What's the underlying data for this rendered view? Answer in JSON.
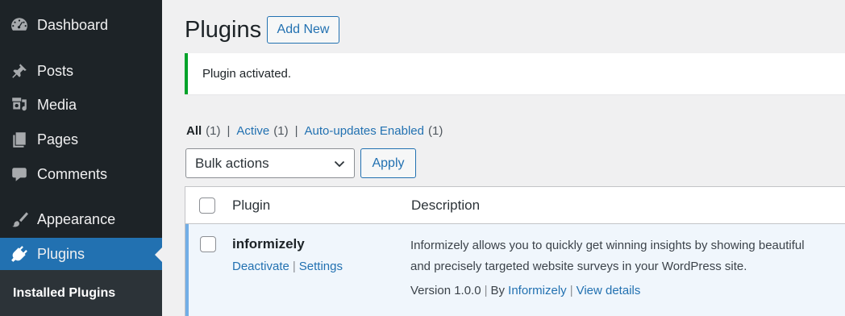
{
  "sidebar": {
    "items": [
      {
        "label": "Dashboard",
        "icon": "dashboard-icon"
      },
      {
        "label": "Posts",
        "icon": "pin-icon"
      },
      {
        "label": "Media",
        "icon": "media-icon"
      },
      {
        "label": "Pages",
        "icon": "pages-icon"
      },
      {
        "label": "Comments",
        "icon": "comment-icon"
      },
      {
        "label": "Appearance",
        "icon": "brush-icon"
      },
      {
        "label": "Plugins",
        "icon": "plug-icon",
        "current": true
      }
    ],
    "submenu": {
      "label": "Installed Plugins"
    }
  },
  "header": {
    "title": "Plugins",
    "add_new_label": "Add New"
  },
  "notice": {
    "text": "Plugin activated."
  },
  "filters": {
    "all": {
      "label": "All",
      "count": "(1)"
    },
    "active": {
      "label": "Active",
      "count": "(1)"
    },
    "auto_updates": {
      "label": "Auto-updates Enabled",
      "count": "(1)"
    },
    "separator": "|"
  },
  "bulk": {
    "selected": "Bulk actions",
    "apply_label": "Apply"
  },
  "table": {
    "headers": {
      "plugin": "Plugin",
      "description": "Description"
    },
    "rows": [
      {
        "name": "informizely",
        "actions": {
          "deactivate": "Deactivate",
          "settings": "Settings"
        },
        "description_line1": "Informizely allows you to quickly get winning insights by showing beautiful",
        "description_line2": "and precisely targeted website surveys in your WordPress site.",
        "version": "Version 1.0.0",
        "by": "By",
        "author": "Informizely",
        "view_details": "View details"
      }
    ]
  },
  "colors": {
    "sidebar_bg": "#1d2327",
    "accent": "#2271b1",
    "notice_success": "#00a32a",
    "active_row_border": "#72aee6"
  }
}
